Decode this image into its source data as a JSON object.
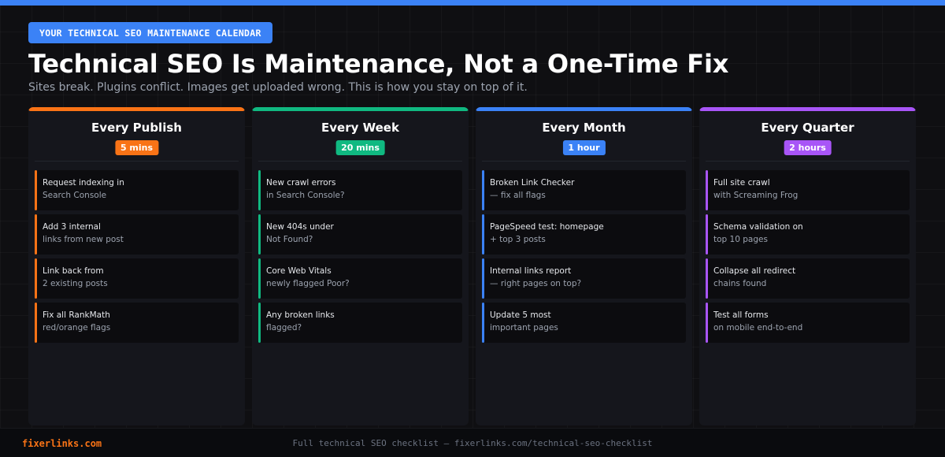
{
  "header": {
    "eyebrow": "YOUR TECHNICAL SEO MAINTENANCE CALENDAR",
    "title": "Technical SEO Is Maintenance, Not a One-Time Fix",
    "subtitle": "Sites break. Plugins conflict. Images get uploaded wrong. This is how you stay on top of it."
  },
  "colors": {
    "top_bar": "#3b82f6",
    "eyebrow_bg": "#3b82f6"
  },
  "columns": [
    {
      "title": "Every Publish",
      "duration": "5 mins",
      "color": "#f97316",
      "tasks": [
        {
          "line1": "Request indexing in",
          "line2": "Search Console"
        },
        {
          "line1": "Add 3 internal",
          "line2": "links from new post"
        },
        {
          "line1": "Link back from",
          "line2": "2 existing posts"
        },
        {
          "line1": "Fix all RankMath",
          "line2": "red/orange flags"
        }
      ]
    },
    {
      "title": "Every Week",
      "duration": "20 mins",
      "color": "#10b981",
      "tasks": [
        {
          "line1": "New crawl errors",
          "line2": "in Search Console?"
        },
        {
          "line1": "New 404s under",
          "line2": "Not Found?"
        },
        {
          "line1": "Core Web Vitals",
          "line2": "newly flagged Poor?"
        },
        {
          "line1": "Any broken links",
          "line2": "flagged?"
        }
      ]
    },
    {
      "title": "Every Month",
      "duration": "1 hour",
      "color": "#3b82f6",
      "tasks": [
        {
          "line1": "Broken Link Checker",
          "line2": "— fix all flags"
        },
        {
          "line1": "PageSpeed test: homepage",
          "line2": "+ top 3 posts"
        },
        {
          "line1": "Internal links report",
          "line2": "— right pages on top?"
        },
        {
          "line1": "Update 5 most",
          "line2": "important pages"
        }
      ]
    },
    {
      "title": "Every Quarter",
      "duration": "2 hours",
      "color": "#a855f7",
      "tasks": [
        {
          "line1": "Full site crawl",
          "line2": "with Screaming Frog"
        },
        {
          "line1": "Schema validation on",
          "line2": "top 10 pages"
        },
        {
          "line1": "Collapse all redirect",
          "line2": "chains found"
        },
        {
          "line1": "Test all forms",
          "line2": "on mobile end-to-end"
        }
      ]
    }
  ],
  "footer": {
    "brand": "fixerlinks.com",
    "brand_color": "#f97316",
    "note": "Full technical SEO checklist — fixerlinks.com/technical-seo-checklist"
  }
}
